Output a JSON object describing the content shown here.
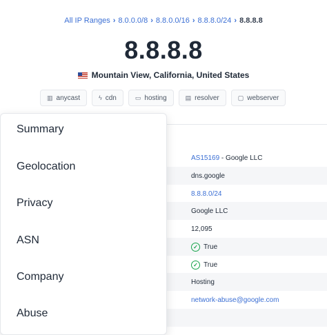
{
  "breadcrumb": {
    "items": [
      "All IP Ranges",
      "8.0.0.0/8",
      "8.8.0.0/16",
      "8.8.8.0/24"
    ],
    "current": "8.8.8.8"
  },
  "ip": {
    "address": "8.8.8.8",
    "location": "Mountain View, California, United States"
  },
  "tags": [
    {
      "label": "anycast",
      "icon": "map-icon"
    },
    {
      "label": "cdn",
      "icon": "bolt-icon"
    },
    {
      "label": "hosting",
      "icon": "server-icon"
    },
    {
      "label": "resolver",
      "icon": "table-icon"
    },
    {
      "label": "webserver",
      "icon": "browser-icon"
    }
  ],
  "details": {
    "asn_link": "AS15169",
    "asn_suffix": " - Google LLC",
    "hostname": "dns.google",
    "range": "8.8.8.0/24",
    "company": "Google LLC",
    "hosted_domains": "12,095",
    "flag_one": "True",
    "flag_two": "True",
    "type": "Hosting",
    "abuse_email": "network-abuse@google.com"
  },
  "menu": {
    "items": [
      "Summary",
      "Geolocation",
      "Privacy",
      "ASN",
      "Company",
      "Abuse"
    ]
  },
  "colors": {
    "link": "#3b6fd4",
    "check": "#16a34a",
    "text": "#1f2937"
  }
}
